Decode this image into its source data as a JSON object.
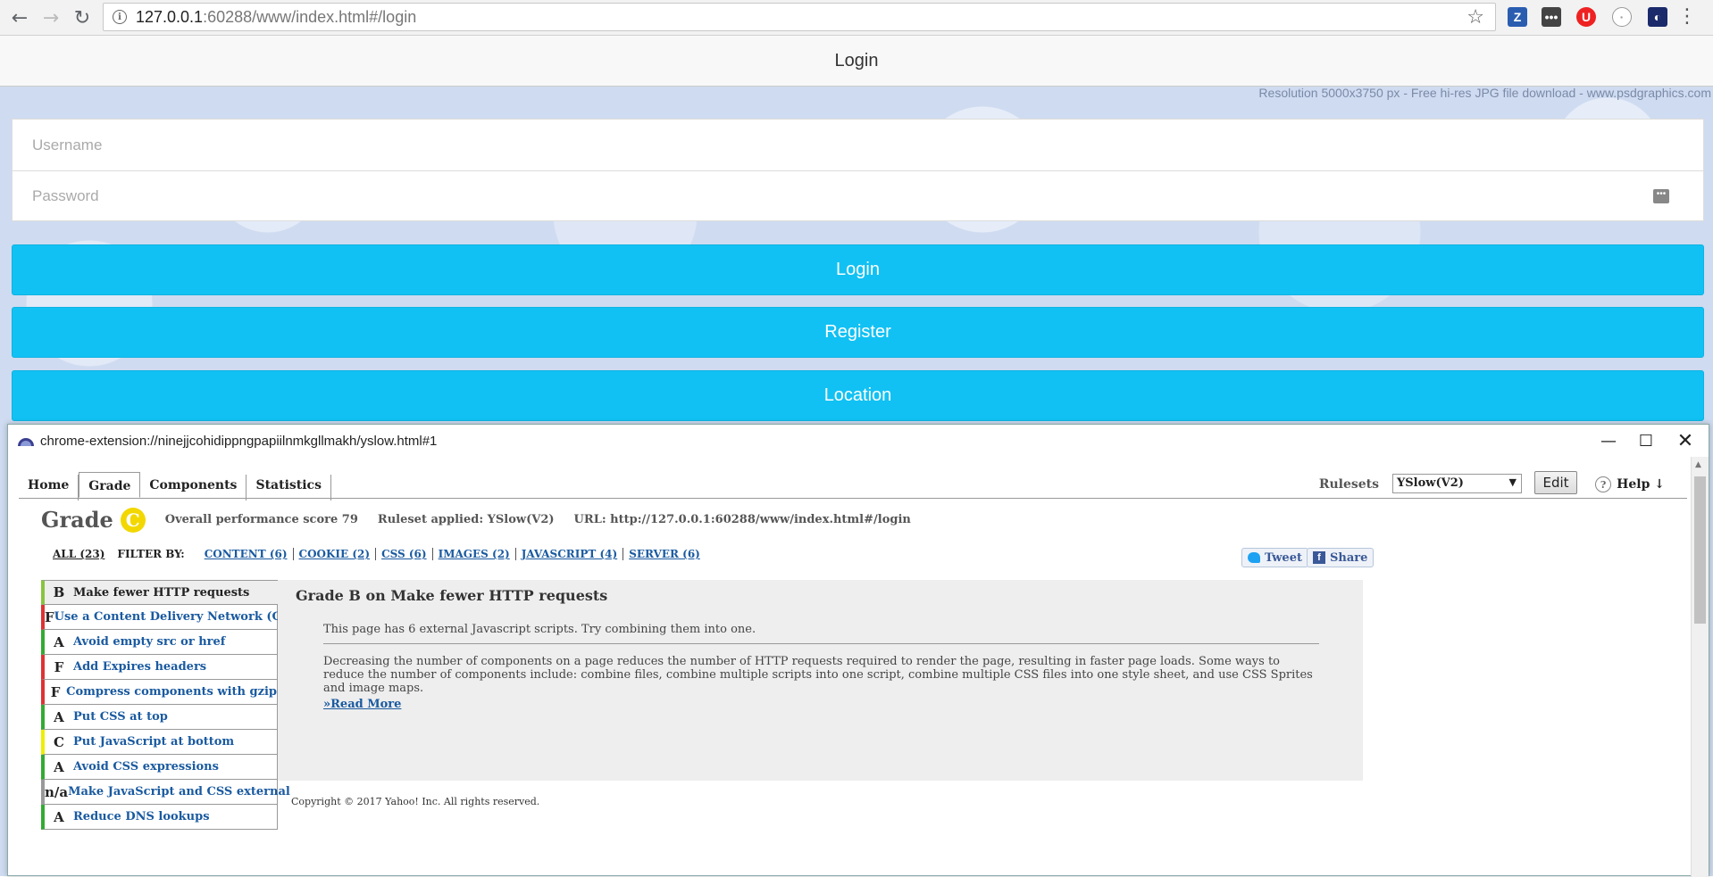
{
  "browser": {
    "url_host": "127.0.0.1",
    "url_rest": ":60288/www/index.html#/login"
  },
  "app": {
    "title": "Login",
    "watermark": "Resolution 5000x3750 px   -   Free hi-res JPG file download   -   www.psdgraphics.com",
    "username_placeholder": "Username",
    "password_placeholder": "Password",
    "buttons": {
      "login": "Login",
      "register": "Register",
      "location": "Location"
    }
  },
  "yslow": {
    "window_title": "chrome-extension://ninejjcohidippngpapiilnmkgllmakh/yslow.html#1",
    "tabs": [
      "Home",
      "Grade",
      "Components",
      "Statistics"
    ],
    "rulesets_label": "Rulesets",
    "ruleset_value": "YSlow(V2)",
    "edit_label": "Edit",
    "help_label": "Help ↓",
    "grade_word": "Grade",
    "grade_letter": "C",
    "overall": "Overall performance score 79",
    "ruleset_applied": "Ruleset applied: YSlow(V2)",
    "url_label": "URL: http://127.0.0.1:60288/www/index.html#/login",
    "filter": {
      "all": "ALL (23)",
      "label": "FILTER BY:",
      "items": [
        "CONTENT (6)",
        "COOKIE (2)",
        "CSS (6)",
        "IMAGES (2)",
        "JAVASCRIPT (4)",
        "SERVER (6)"
      ]
    },
    "tweet": "Tweet",
    "share": "Share",
    "rules": [
      {
        "grade": "B",
        "name": "Make fewer HTTP requests",
        "color": "#8ac43f"
      },
      {
        "grade": "F",
        "name": "Use a Content Delivery Network (CDN)",
        "color": "#d33"
      },
      {
        "grade": "A",
        "name": "Avoid empty src or href",
        "color": "#3a3"
      },
      {
        "grade": "F",
        "name": "Add Expires headers",
        "color": "#d33"
      },
      {
        "grade": "F",
        "name": "Compress components with gzip",
        "color": "#d33"
      },
      {
        "grade": "A",
        "name": "Put CSS at top",
        "color": "#3a3"
      },
      {
        "grade": "C",
        "name": "Put JavaScript at bottom",
        "color": "#ee0"
      },
      {
        "grade": "A",
        "name": "Avoid CSS expressions",
        "color": "#3a3"
      },
      {
        "grade": "n/a",
        "name": "Make JavaScript and CSS external",
        "color": "#999"
      },
      {
        "grade": "A",
        "name": "Reduce DNS lookups",
        "color": "#3a3"
      }
    ],
    "detail": {
      "title": "Grade B on Make fewer HTTP requests",
      "summary": "This page has 6 external Javascript scripts. Try combining them into one.",
      "description": "Decreasing the number of components on a page reduces the number of HTTP requests required to render the page, resulting in faster page loads. Some ways to reduce the number of components include: combine files, combine multiple scripts into one script, combine multiple CSS files into one style sheet, and use CSS Sprites and image maps.",
      "read_more": "»Read More"
    },
    "copyright": "Copyright © 2017 Yahoo! Inc. All rights reserved."
  }
}
